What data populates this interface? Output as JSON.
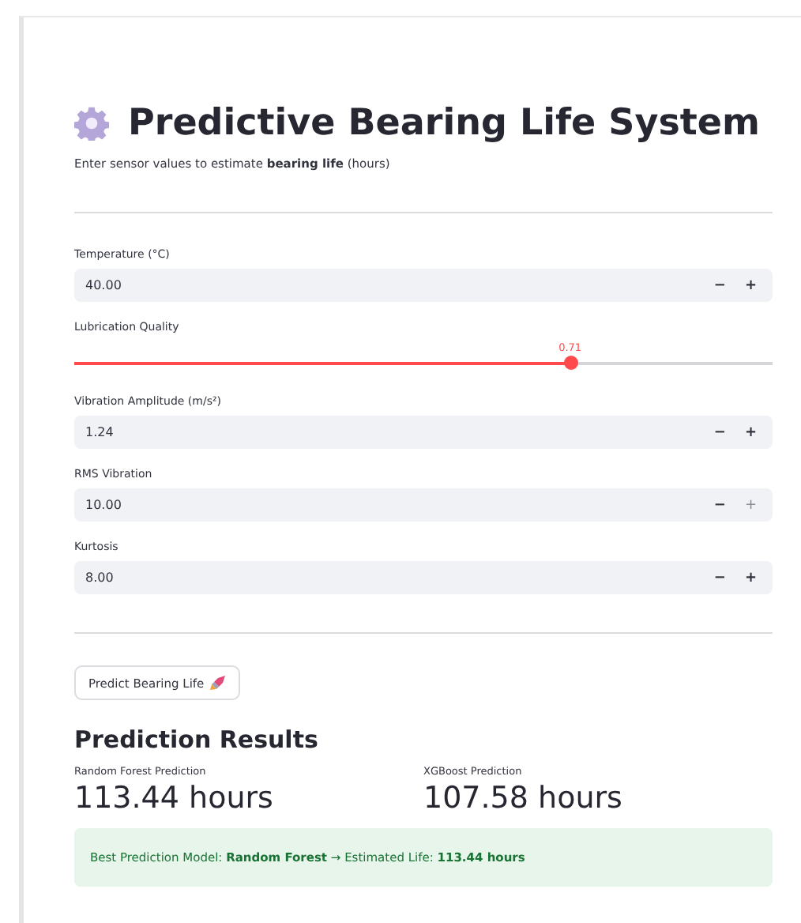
{
  "header": {
    "title": "Predictive Bearing Life System",
    "subtitle": "Enter sensor values to estimate **bearing life** (hours)"
  },
  "inputs": [
    {
      "kind": "number",
      "label": "Temperature (°C)",
      "value": "40.00",
      "minus": "−",
      "plus": "+",
      "plus_disabled": false
    },
    {
      "kind": "slider",
      "label": "Lubrication Quality",
      "reading": "0.71",
      "level": 0.71
    },
    {
      "kind": "number",
      "label": "Vibration Amplitude (m/s²)",
      "value": "1.24",
      "minus": "−",
      "plus": "+",
      "plus_disabled": false
    },
    {
      "kind": "number",
      "label": "RMS Vibration",
      "value": "10.00",
      "minus": "−",
      "plus": "+",
      "plus_disabled": true
    },
    {
      "kind": "number",
      "label": "Kurtosis",
      "value": "8.00",
      "minus": "−",
      "plus": "+",
      "plus_disabled": false
    }
  ],
  "predict_button": {
    "label": "Predict Bearing Life"
  },
  "results": {
    "title": "Prediction Results",
    "metrics": [
      {
        "label": "Random Forest Prediction",
        "value": "113.44 hours"
      },
      {
        "label": "XGBoost Prediction",
        "value": "107.58 hours"
      }
    ],
    "success": "Best Prediction Model: **Random Forest** → Estimated Life: **113.44 hours**"
  }
}
